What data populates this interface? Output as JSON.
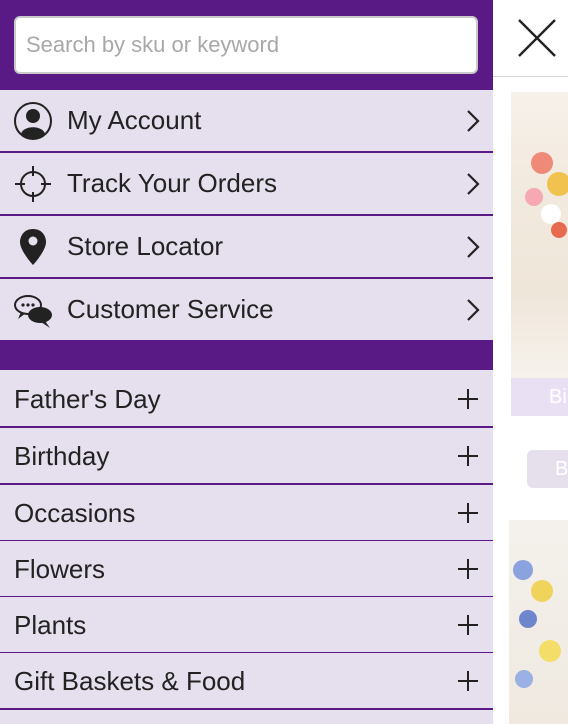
{
  "search": {
    "placeholder": "Search by sku or keyword",
    "value": ""
  },
  "account_menu": [
    {
      "label": "My Account",
      "icon": "user-icon"
    },
    {
      "label": "Track Your Orders",
      "icon": "crosshair-icon"
    },
    {
      "label": "Store Locator",
      "icon": "map-pin-icon"
    },
    {
      "label": "Customer Service",
      "icon": "chat-bubbles-icon"
    }
  ],
  "categories": [
    {
      "label": "Father's Day"
    },
    {
      "label": "Birthday"
    },
    {
      "label": "Occasions"
    },
    {
      "label": "Flowers"
    },
    {
      "label": "Plants"
    },
    {
      "label": "Gift Baskets & Food"
    }
  ],
  "background_page": {
    "label_fragment": "Bi",
    "button_fragment": "B"
  },
  "colors": {
    "brand_purple": "#5a1a86",
    "menu_background": "#e6dfee"
  }
}
